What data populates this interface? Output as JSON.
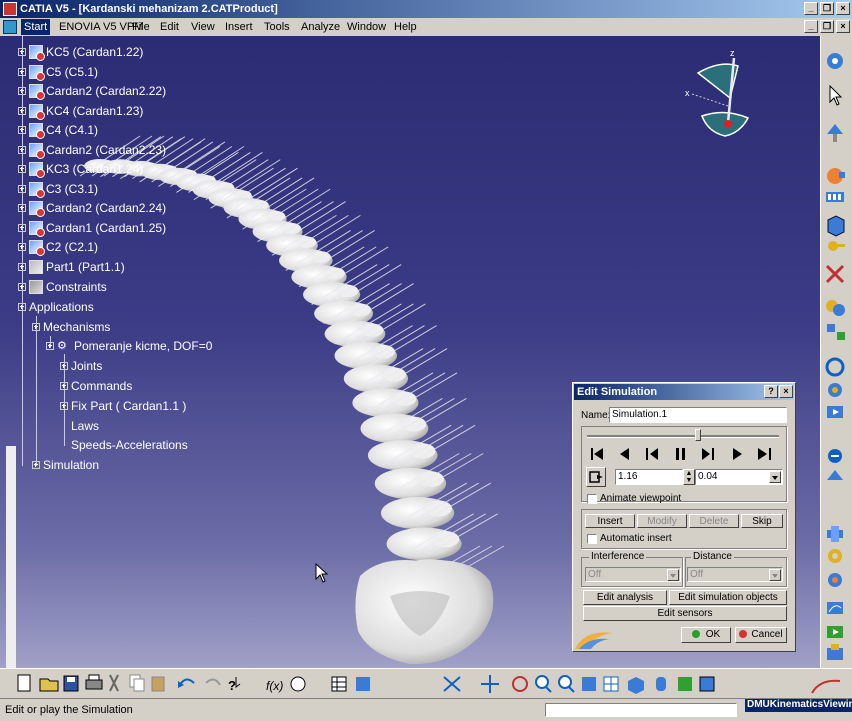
{
  "window": {
    "title": "CATIA V5 - [Kardanski mehanizam 2.CATProduct]"
  },
  "menu": {
    "items": [
      {
        "label": "Start",
        "active": true
      },
      {
        "label": "ENOVIA V5 VPM"
      },
      {
        "label": "File"
      },
      {
        "label": "Edit"
      },
      {
        "label": "View"
      },
      {
        "label": "Insert"
      },
      {
        "label": "Tools"
      },
      {
        "label": "Analyze"
      },
      {
        "label": "Window"
      },
      {
        "label": "Help"
      }
    ]
  },
  "tree": {
    "nodes": [
      {
        "label": "KC5 (Cardan1.22)",
        "icon": "part-icon"
      },
      {
        "label": "C5 (C5.1)",
        "icon": "part-icon"
      },
      {
        "label": "Cardan2 (Cardan2.22)",
        "icon": "part-icon"
      },
      {
        "label": "KC4 (Cardan1.23)",
        "icon": "part-icon"
      },
      {
        "label": "C4 (C4.1)",
        "icon": "part-icon"
      },
      {
        "label": "Cardan2 (Cardan2.23)",
        "icon": "part-icon"
      },
      {
        "label": "KC3 (Cardan1.24)",
        "icon": "part-icon"
      },
      {
        "label": "C3 (C3.1)",
        "icon": "part-icon"
      },
      {
        "label": "Cardan2 (Cardan2.24)",
        "icon": "part-icon"
      },
      {
        "label": "Cardan1 (Cardan1.25)",
        "icon": "part-icon"
      },
      {
        "label": "C2 (C2.1)",
        "icon": "part-icon"
      },
      {
        "label": "Part1 (Part1.1)",
        "icon": "part-icon"
      },
      {
        "label": "Constraints",
        "icon": "constraints-icon"
      },
      {
        "label": "Applications",
        "icon": "none"
      },
      {
        "label": "Mechanisms",
        "icon": "none"
      },
      {
        "label": "Pomeranje kicme, DOF=0",
        "icon": "mechanism-icon"
      },
      {
        "label": "Joints",
        "icon": "none"
      },
      {
        "label": "Commands",
        "icon": "none"
      },
      {
        "label": "Fix Part ( Cardan1.1 )",
        "icon": "none"
      },
      {
        "label": "Laws",
        "icon": "none"
      },
      {
        "label": "Speeds-Accelerations",
        "icon": "none"
      },
      {
        "label": "Simulation",
        "icon": "none"
      }
    ]
  },
  "compass": {
    "x_label": "x",
    "z_label": "z"
  },
  "dialog": {
    "title": "Edit Simulation",
    "help": "?",
    "close": "×",
    "name_label": "Name:",
    "name_value": "Simulation.1",
    "slider_level": 0.58,
    "step_value": "1.16",
    "step_size": "0.04",
    "animate_viewpoint": "Animate viewpoint",
    "insert": "Insert",
    "modify": "Modify",
    "delete": "Delete",
    "skip": "Skip",
    "automatic_insert": "Automatic insert",
    "interference_label": "Interference",
    "interference_value": "Off",
    "distance_label": "Distance",
    "distance_value": "Off",
    "edit_analysis": "Edit analysis",
    "edit_sim_objects": "Edit simulation objects",
    "edit_sensors": "Edit sensors",
    "ok": "OK",
    "cancel": "Cancel"
  },
  "status": {
    "text": "Edit or play the Simulation",
    "workbench": "DMUKinematicsViewing"
  },
  "colors": {
    "titlebar": "#0a246a",
    "viewport_top": "#2c2c74",
    "viewport_bottom": "#a0a0c8",
    "ok_icon": "#2a9d2a",
    "cancel_icon": "#d83030"
  }
}
